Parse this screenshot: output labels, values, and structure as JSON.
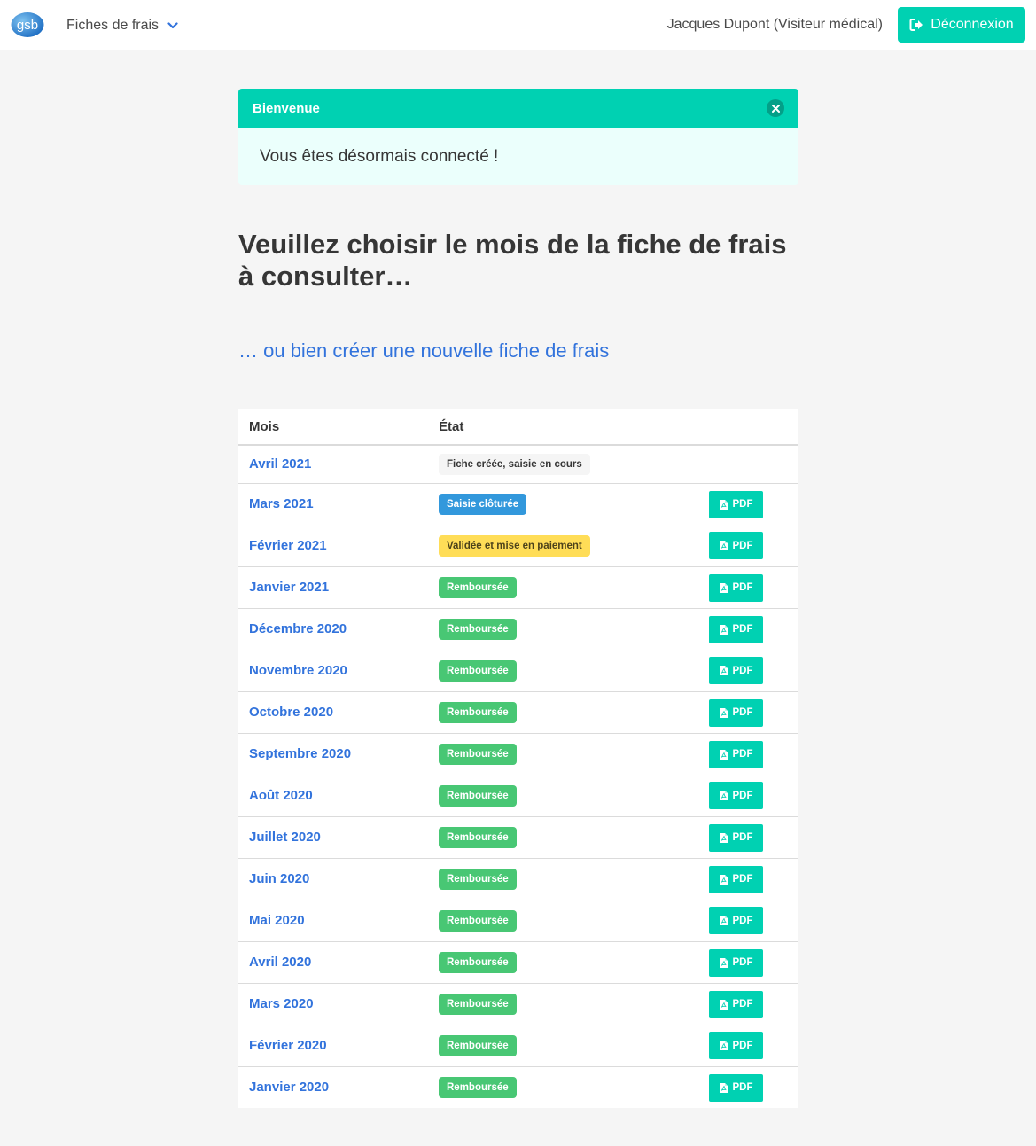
{
  "navbar": {
    "logo_text": "gsb",
    "dropdown_label": "Fiches de frais",
    "user_label": "Jacques Dupont (Visiteur médical)",
    "logout_label": "Déconnexion"
  },
  "notification": {
    "header": "Bienvenue",
    "body": "Vous êtes désormais connecté !"
  },
  "page": {
    "title": "Veuillez choisir le mois de la fiche de frais à consulter…",
    "create_link": "… ou bien créer une nouvelle fiche de frais"
  },
  "table": {
    "headers": [
      "Mois",
      "État",
      ""
    ],
    "pdf_label": "PDF",
    "rows": [
      {
        "month": "Avril 2021",
        "status": "Fiche créée, saisie en cours",
        "status_type": "light",
        "pdf": false
      },
      {
        "month": "Mars 2021",
        "status": "Saisie clôturée",
        "status_type": "info",
        "pdf": true
      },
      {
        "month": "Février 2021",
        "status": "Validée et mise en paiement",
        "status_type": "warning",
        "pdf": true
      },
      {
        "month": "Janvier 2021",
        "status": "Remboursée",
        "status_type": "success",
        "pdf": true
      },
      {
        "month": "Décembre 2020",
        "status": "Remboursée",
        "status_type": "success",
        "pdf": true
      },
      {
        "month": "Novembre 2020",
        "status": "Remboursée",
        "status_type": "success",
        "pdf": true
      },
      {
        "month": "Octobre 2020",
        "status": "Remboursée",
        "status_type": "success",
        "pdf": true
      },
      {
        "month": "Septembre 2020",
        "status": "Remboursée",
        "status_type": "success",
        "pdf": true
      },
      {
        "month": "Août 2020",
        "status": "Remboursée",
        "status_type": "success",
        "pdf": true
      },
      {
        "month": "Juillet 2020",
        "status": "Remboursée",
        "status_type": "success",
        "pdf": true
      },
      {
        "month": "Juin 2020",
        "status": "Remboursée",
        "status_type": "success",
        "pdf": true
      },
      {
        "month": "Mai 2020",
        "status": "Remboursée",
        "status_type": "success",
        "pdf": true
      },
      {
        "month": "Avril 2020",
        "status": "Remboursée",
        "status_type": "success",
        "pdf": true
      },
      {
        "month": "Mars 2020",
        "status": "Remboursée",
        "status_type": "success",
        "pdf": true
      },
      {
        "month": "Février 2020",
        "status": "Remboursée",
        "status_type": "success",
        "pdf": true
      },
      {
        "month": "Janvier 2020",
        "status": "Remboursée",
        "status_type": "success",
        "pdf": true
      }
    ]
  },
  "colors": {
    "primary": "#00d1b2",
    "link": "#3273dc",
    "info": "#3298dc",
    "warning": "#ffdd57",
    "success": "#48c774"
  }
}
